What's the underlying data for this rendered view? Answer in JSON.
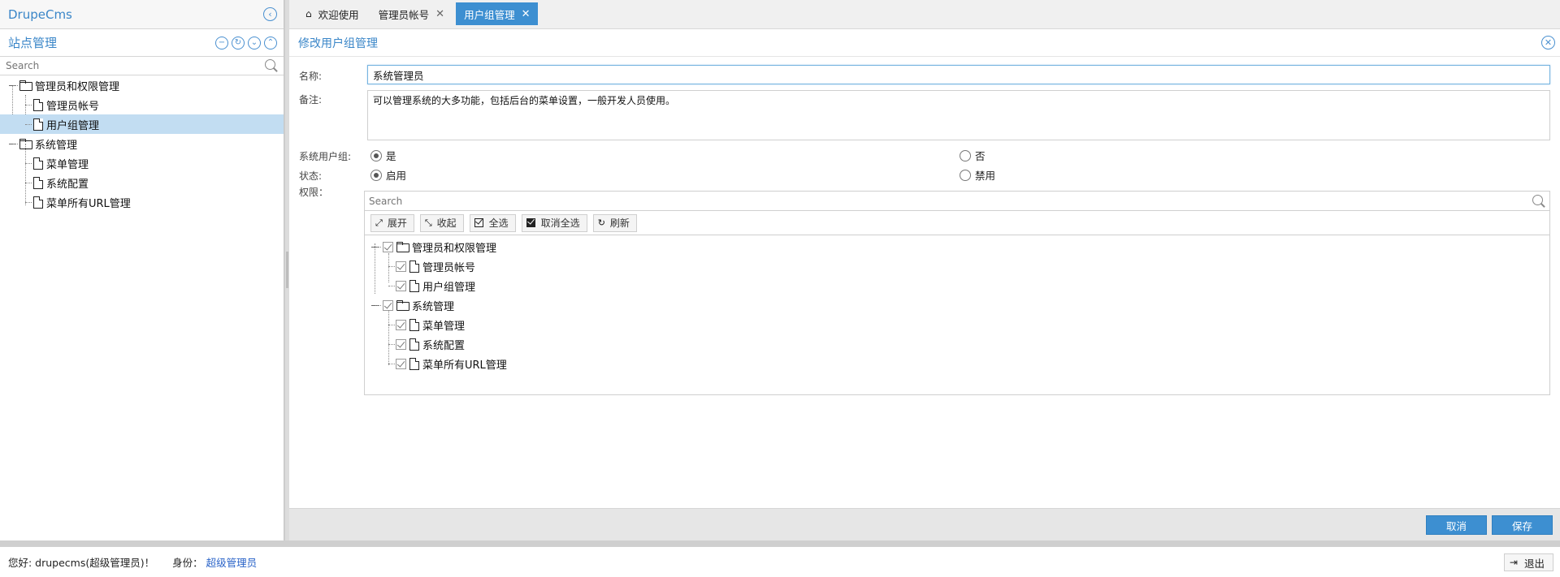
{
  "app": {
    "title": "DrupeCms"
  },
  "sidebar": {
    "title": "站点管理",
    "search_placeholder": "Search",
    "tree": [
      {
        "label": "管理员和权限管理",
        "type": "folder"
      },
      {
        "label": "管理员帐号",
        "type": "file"
      },
      {
        "label": "用户组管理",
        "type": "file",
        "selected": true
      },
      {
        "label": "系统管理",
        "type": "folder"
      },
      {
        "label": "菜单管理",
        "type": "file"
      },
      {
        "label": "系统配置",
        "type": "file"
      },
      {
        "label": "菜单所有URL管理",
        "type": "file"
      }
    ]
  },
  "tabs": [
    {
      "label": "欢迎使用",
      "icon": "home-icon"
    },
    {
      "label": "管理员帐号",
      "closable": true
    },
    {
      "label": "用户组管理",
      "closable": true,
      "active": true
    }
  ],
  "form": {
    "title": "修改用户组管理",
    "name_label": "名称:",
    "name_value": "系统管理员",
    "remark_label": "备注:",
    "remark_value": "可以管理系统的大多功能，包括后台的菜单设置，一般开发人员使用。",
    "sys_group_label": "系统用户组:",
    "sys_group_yes": "是",
    "sys_group_no": "否",
    "sys_group_selected": "是",
    "status_label": "状态:",
    "status_enabled": "启用",
    "status_disabled": "禁用",
    "status_selected": "启用",
    "perm_label": "权限：",
    "perm_search_placeholder": "Search",
    "perm_tools": {
      "expand": "展开",
      "collapse": "收起",
      "select_all": "全选",
      "deselect_all": "取消全选",
      "refresh": "刷新"
    },
    "perm_tree": [
      {
        "label": "管理员和权限管理",
        "type": "folder",
        "checked": true
      },
      {
        "label": "管理员帐号",
        "type": "file",
        "checked": true
      },
      {
        "label": "用户组管理",
        "type": "file",
        "checked": true
      },
      {
        "label": "系统管理",
        "type": "folder",
        "checked": true
      },
      {
        "label": "菜单管理",
        "type": "file",
        "checked": true
      },
      {
        "label": "系统配置",
        "type": "file",
        "checked": true
      },
      {
        "label": "菜单所有URL管理",
        "type": "file",
        "checked": true
      }
    ],
    "cancel_label": "取消",
    "save_label": "保存"
  },
  "status": {
    "greeting": "您好: drupecms(超级管理员)！",
    "role_label": "身份：",
    "role_value": "超级管理员",
    "logout_label": "退出"
  },
  "colors": {
    "accent": "#3d8fd1",
    "selected_row": "#c2ddf2",
    "role_link": "#2a63c8"
  }
}
